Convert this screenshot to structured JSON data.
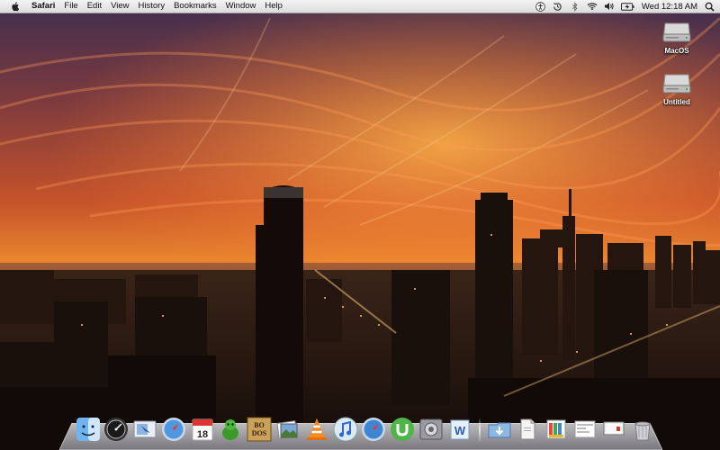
{
  "menubar": {
    "app_name": "Safari",
    "menus": [
      "File",
      "Edit",
      "View",
      "History",
      "Bookmarks",
      "Window",
      "Help"
    ],
    "status_icons": [
      "accessibility-icon",
      "time-machine-icon",
      "bluetooth-icon",
      "wifi-icon",
      "volume-icon",
      "battery-icon"
    ],
    "clock": "Wed 12:18 AM"
  },
  "desktop": {
    "icons": [
      {
        "label": "MacOS",
        "icon": "hard-drive-icon"
      },
      {
        "label": "Untitled",
        "icon": "hard-drive-icon"
      }
    ]
  },
  "dock": {
    "apps": [
      "finder-icon",
      "dashboard-icon",
      "mail-icon",
      "safari-icon",
      "ical-icon",
      "adium-icon",
      "dosbox-icon",
      "iphoto-icon",
      "vlc-icon",
      "itunes-icon",
      "safari-beta-icon",
      "utorrent-icon",
      "system-preferences-icon",
      "word-icon"
    ],
    "stacks": [
      "downloads-stack-icon",
      "documents-stack-icon",
      "applications-stack-icon",
      "preview-stack-icon",
      "monitor-stack-icon",
      "trash-icon"
    ]
  }
}
